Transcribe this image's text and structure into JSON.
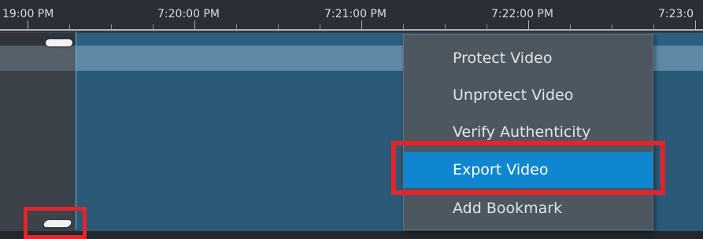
{
  "timeline": {
    "time_labels": [
      "19:00 PM",
      "7:20:00 PM",
      "7:21:00 PM",
      "7:22:00 PM",
      "7:23:0"
    ]
  },
  "context_menu": {
    "items": [
      {
        "label": "Protect Video"
      },
      {
        "label": "Unprotect Video"
      },
      {
        "label": "Verify Authenticity"
      },
      {
        "label": "Export Video"
      },
      {
        "label": "Add Bookmark"
      }
    ],
    "active_item": "Export Video"
  },
  "colors": {
    "highlight_red": "#e2252b",
    "menu_active": "#0f86cf",
    "clip_blue": "#2a5a78",
    "menu_bg": "#4d5760"
  }
}
